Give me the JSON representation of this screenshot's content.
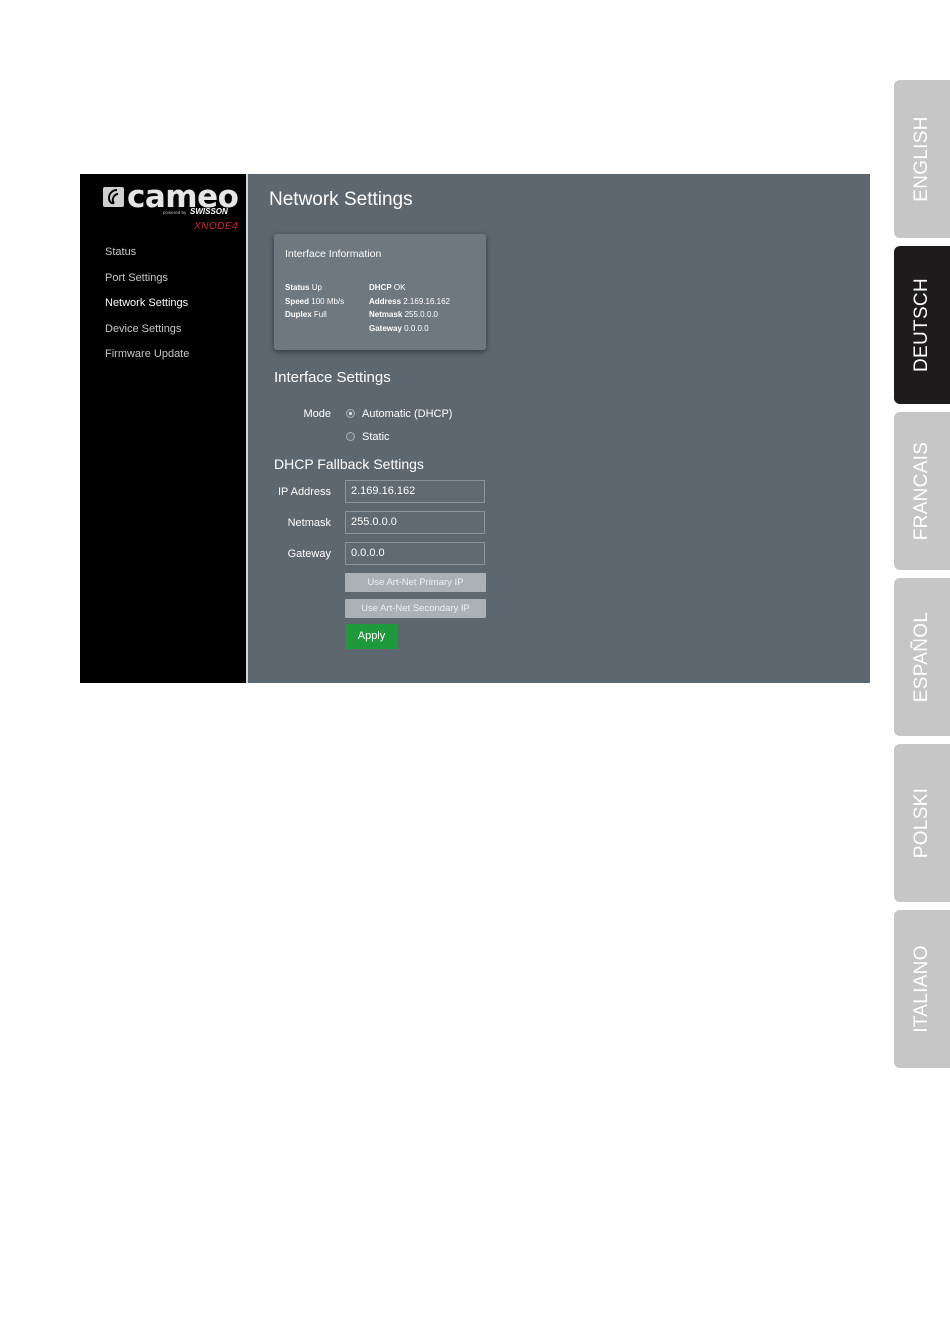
{
  "languages": [
    "ENGLISH",
    "DEUTSCH",
    "FRANCAIS",
    "ESPAÑOL",
    "POLSKI",
    "ITALIANO"
  ],
  "active_language": "DEUTSCH",
  "logo": {
    "brand": "cameo",
    "powered_by": "powered by",
    "partner": "SWISSON",
    "model": "XNODE4"
  },
  "sidebar": {
    "items": [
      {
        "label": "Status"
      },
      {
        "label": "Port Settings"
      },
      {
        "label": "Network Settings"
      },
      {
        "label": "Device Settings"
      },
      {
        "label": "Firmware Update"
      }
    ],
    "active": "Network Settings"
  },
  "page": {
    "title": "Network Settings"
  },
  "interface_info": {
    "title": "Interface Information",
    "status_label": "Status",
    "status_value": "Up",
    "speed_label": "Speed",
    "speed_value": "100 Mb/s",
    "duplex_label": "Duplex",
    "duplex_value": "Full",
    "dhcp_label": "DHCP",
    "dhcp_value": "OK",
    "address_label": "Address",
    "address_value": "2.169.16.162",
    "netmask_label": "Netmask",
    "netmask_value": "255.0.0.0",
    "gateway_label": "Gateway",
    "gateway_value": "0.0.0.0"
  },
  "interface_settings": {
    "title": "Interface Settings",
    "mode_label": "Mode",
    "mode_options": [
      "Automatic (DHCP)",
      "Static"
    ],
    "mode_selected": "Automatic (DHCP)"
  },
  "fallback": {
    "title": "DHCP Fallback Settings",
    "ip_label": "IP Address",
    "ip_value": "2.169.16.162",
    "netmask_label": "Netmask",
    "netmask_value": "255.0.0.0",
    "gateway_label": "Gateway",
    "gateway_value": "0.0.0.0",
    "primary_button": "Use Art-Net Primary IP",
    "secondary_button": "Use Art-Net Secondary IP",
    "apply_button": "Apply"
  },
  "colors": {
    "sidebar_bg": "#000000",
    "content_bg": "#5c6770",
    "apply_green": "#1e9a3c",
    "model_red": "#d0202e",
    "tab_active": "#1e1b1c",
    "tab_inactive": "#c6c6c6"
  }
}
